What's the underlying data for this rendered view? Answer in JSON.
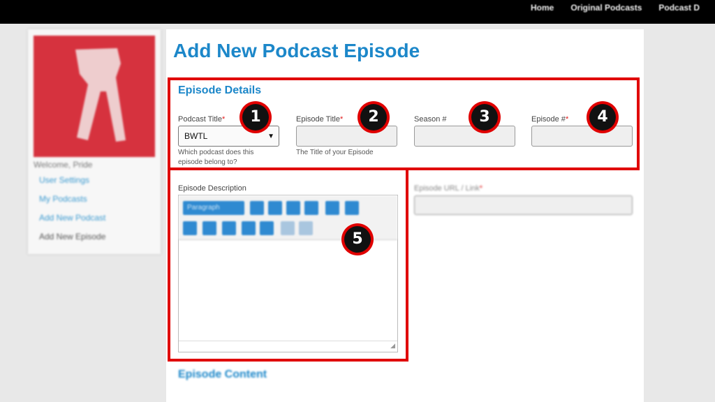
{
  "nav": {
    "items": [
      "Home",
      "Original Podcasts",
      "Podcast D"
    ]
  },
  "sidebar": {
    "welcome": "Welcome, Pride",
    "links": [
      "User Settings",
      "My Podcasts",
      "Add New Podcast",
      "Add New Episode"
    ]
  },
  "page": {
    "title": "Add New Podcast Episode"
  },
  "details": {
    "title": "Episode Details",
    "podcast_title_label": "Podcast Title",
    "podcast_title_value": "BWTL",
    "podcast_title_help": "Which podcast does this episode belong to?",
    "episode_title_label": "Episode Title",
    "episode_title_help": "The Title of your Episode",
    "season_label": "Season #",
    "episode_num_label": "Episode #",
    "required_mark": "*",
    "description_label": "Episode Description",
    "format_select": "Paragraph",
    "url_label": "Episode URL / Link"
  },
  "content": {
    "title": "Episode Content"
  },
  "badges": [
    "1",
    "2",
    "3",
    "4",
    "5"
  ],
  "colors": {
    "accent": "#1c87c9",
    "highlight": "#e00000",
    "required": "#e01a1a"
  }
}
